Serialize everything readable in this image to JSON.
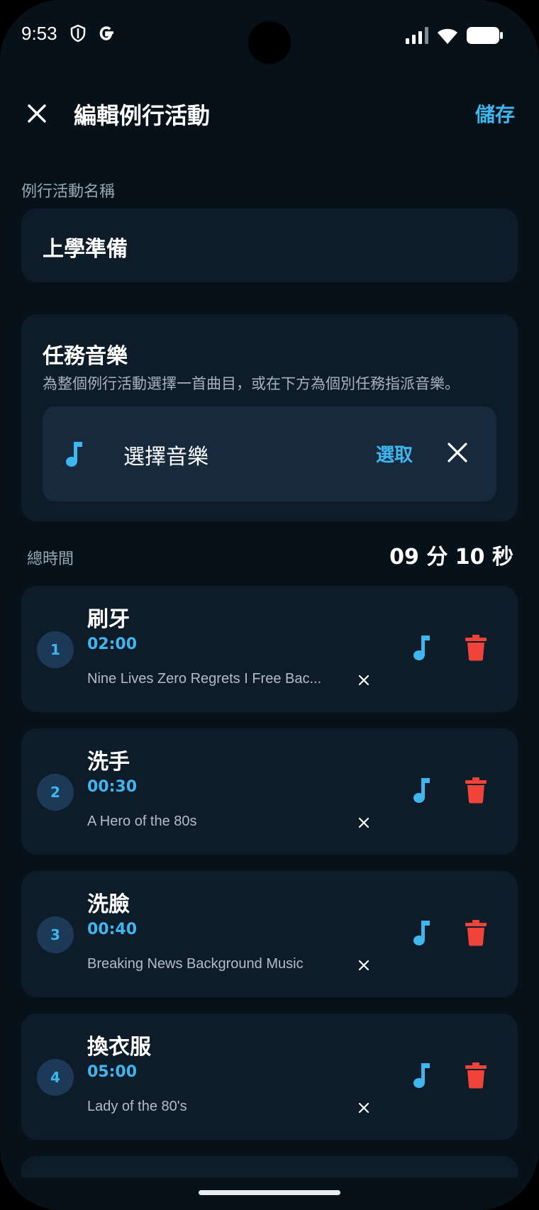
{
  "status_bar": {
    "time": "9:53",
    "icons": [
      "shield-icon",
      "google-icon",
      "signal-icon",
      "wifi-icon",
      "battery-icon"
    ]
  },
  "header": {
    "title": "編輯例行活動",
    "save_label": "儲存",
    "close_icon": "close-icon"
  },
  "routine_name": {
    "label": "例行活動名稱",
    "value": "上學準備"
  },
  "task_music": {
    "title": "任務音樂",
    "description": "為整個例行活動選擇一首曲目，或在下方為個別任務指派音樂。",
    "select_label": "選擇音樂",
    "pick_label": "選取",
    "music_icon": "music-note-icon",
    "clear_icon": "close-icon"
  },
  "total_time": {
    "label": "總時間",
    "value": "09 分 10 秒"
  },
  "tasks": [
    {
      "number": "1",
      "name": "刷牙",
      "duration": "02:00",
      "track": "Nine Lives Zero Regrets I Free Bac..."
    },
    {
      "number": "2",
      "name": "洗手",
      "duration": "00:30",
      "track": "A Hero of the 80s"
    },
    {
      "number": "3",
      "name": "洗臉",
      "duration": "00:40",
      "track": "Breaking News Background Music"
    },
    {
      "number": "4",
      "name": "換衣服",
      "duration": "05:00",
      "track": "Lady of the 80's"
    }
  ],
  "colors": {
    "background": "#07111a",
    "card": "#0e1c2a",
    "accent": "#3fb6ee",
    "delete": "#f0443a",
    "muted_text": "#9aa7b3"
  }
}
